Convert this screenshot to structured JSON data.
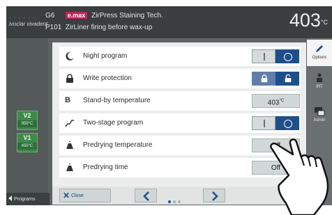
{
  "header": {
    "brand": "ivoclar vivadent",
    "row1_code": "G6",
    "row1_badge": "e.max",
    "row1_text": "ZirPress Staining Tech.",
    "row2_code": "P101",
    "row2_text": "ZirLiner firing before wax-up",
    "temperature": "403",
    "temperature_unit": "°C"
  },
  "left": {
    "v2": {
      "label": "V2",
      "temp": "959°C"
    },
    "v1": {
      "label": "V1",
      "temp": "450°C"
    },
    "programs_label": "Programs"
  },
  "right_tabs": [
    {
      "label": "Options",
      "icon": "pencil-icon",
      "active": true
    },
    {
      "label": "IRT",
      "icon": "irt-sensor-icon",
      "active": false
    },
    {
      "label": "Admin",
      "icon": "admin-icon",
      "active": false
    }
  ],
  "settings": [
    {
      "label": "Night program",
      "icon": "night-moon-icon",
      "control": "toggle",
      "state": "on"
    },
    {
      "label": "Write protection",
      "icon": "padlock-icon",
      "control": "lock-toggle",
      "state": "unlocked"
    },
    {
      "label": "Stand-by temperature",
      "icon": "b-letter-icon",
      "control": "value",
      "value": "403",
      "unit": "°C"
    },
    {
      "label": "Two-stage program",
      "icon": "two-stage-curve-icon",
      "control": "toggle",
      "state": "on"
    },
    {
      "label": "Predrying temperature",
      "icon": "predrying-temp-icon",
      "control": "value",
      "value": "Off"
    },
    {
      "label": "Predrying time",
      "icon": "predrying-time-icon",
      "control": "value",
      "value": "Off"
    }
  ],
  "footer": {
    "close_label": "Close",
    "page_indicator": {
      "pages": 3,
      "current": 1
    }
  },
  "colors": {
    "accent_blue": "#1f4f8a",
    "vbox_green": "#3f8a4a",
    "emax_badge": "#c0245a"
  }
}
